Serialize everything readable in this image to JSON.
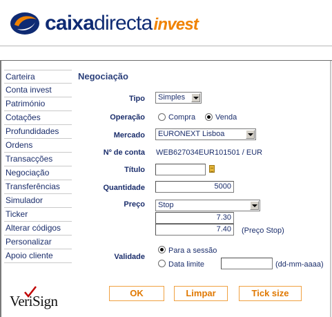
{
  "brand": {
    "caixa": "caixa",
    "directa": "directa",
    "invest": "invest"
  },
  "sidebar": {
    "items": [
      {
        "label": "Carteira"
      },
      {
        "label": "Conta invest"
      },
      {
        "label": "Património"
      },
      {
        "label": "Cotações"
      },
      {
        "label": "Profundidades"
      },
      {
        "label": "Ordens"
      },
      {
        "label": "Transacções"
      },
      {
        "label": "Negociação"
      },
      {
        "label": "Transferências"
      },
      {
        "label": "Simulador"
      },
      {
        "label": "Ticker"
      },
      {
        "label": "Alterar códigos"
      },
      {
        "label": "Personalizar"
      },
      {
        "label": "Apoio cliente"
      }
    ]
  },
  "verisign": "VeriSign",
  "form": {
    "title": "Negociação",
    "tipo": {
      "label": "Tipo",
      "value": "Simples"
    },
    "operacao": {
      "label": "Operação",
      "option1": "Compra",
      "option2": "Venda",
      "selected": "Venda"
    },
    "mercado": {
      "label": "Mercado",
      "value": "EURONEXT Lisboa"
    },
    "conta": {
      "label": "Nº de conta",
      "value": "WEB627034EUR101501 / EUR"
    },
    "titulo": {
      "label": "Título",
      "value": ""
    },
    "quantidade": {
      "label": "Quantidade",
      "value": "5000"
    },
    "preco": {
      "label": "Preço",
      "type": "Stop",
      "price": "7.30",
      "stop_price": "7.40",
      "stop_label": "(Preço Stop)"
    },
    "validade": {
      "label": "Validade",
      "option1": "Para a sessão",
      "option2": "Data limite",
      "date_value": "",
      "date_hint": "(dd-mm-aaaa)",
      "selected": "Para a sessão"
    }
  },
  "buttons": {
    "ok": "OK",
    "limpar": "Limpar",
    "tick_size": "Tick size"
  },
  "colors": {
    "brand_blue": "#0f2b73",
    "brand_orange": "#f08200",
    "nav_text": "#1a2d6b",
    "button_border": "#f0a040"
  }
}
